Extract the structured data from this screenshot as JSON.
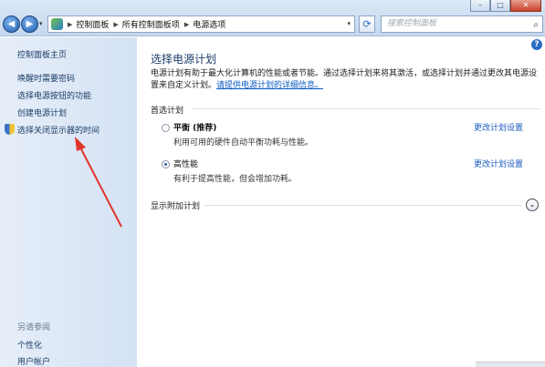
{
  "window": {
    "minimize": "–",
    "maximize": "□",
    "close": "✕"
  },
  "nav": {
    "back_icon": "◀",
    "forward_icon": "▶",
    "history_dropdown": "▾"
  },
  "address_bar": {
    "breadcrumbs": [
      "控制面板",
      "所有控制面板项",
      "电源选项"
    ],
    "dropdown_icon": "▾",
    "refresh_icon": "⟳"
  },
  "search": {
    "placeholder": "搜索控制面板",
    "icon": "⌕"
  },
  "sidebar": {
    "home": "控制面板主页",
    "links": [
      "唤醒时需要密码",
      "选择电源按钮的功能",
      "创建电源计划",
      "选择关闭显示器的时间"
    ],
    "see_also_label": "另请参阅",
    "see_also": [
      "个性化",
      "用户帐户"
    ]
  },
  "main": {
    "help_icon": "?",
    "title": "选择电源计划",
    "description": "电源计划有助于最大化计算机的性能或者节能。通过选择计划来将其激活，或选择计划并通过更改其电源设置来自定义计划。",
    "description_link": "请提供电源计划的详细信息。",
    "preferred_label": "首选计划",
    "plans": [
      {
        "name": "平衡 (推荐)",
        "desc": "利用可用的硬件自动平衡功耗与性能。",
        "link": "更改计划设置",
        "selected": false
      },
      {
        "name": "高性能",
        "desc": "有利于提高性能，但会增加功耗。",
        "link": "更改计划设置",
        "selected": true
      }
    ],
    "additional_label": "显示附加计划",
    "expand_icon": "⌄"
  },
  "colors": {
    "link": "#1a5bbf",
    "sidebar_link": "#1c3d66",
    "annotation_arrow": "#e0352b"
  }
}
